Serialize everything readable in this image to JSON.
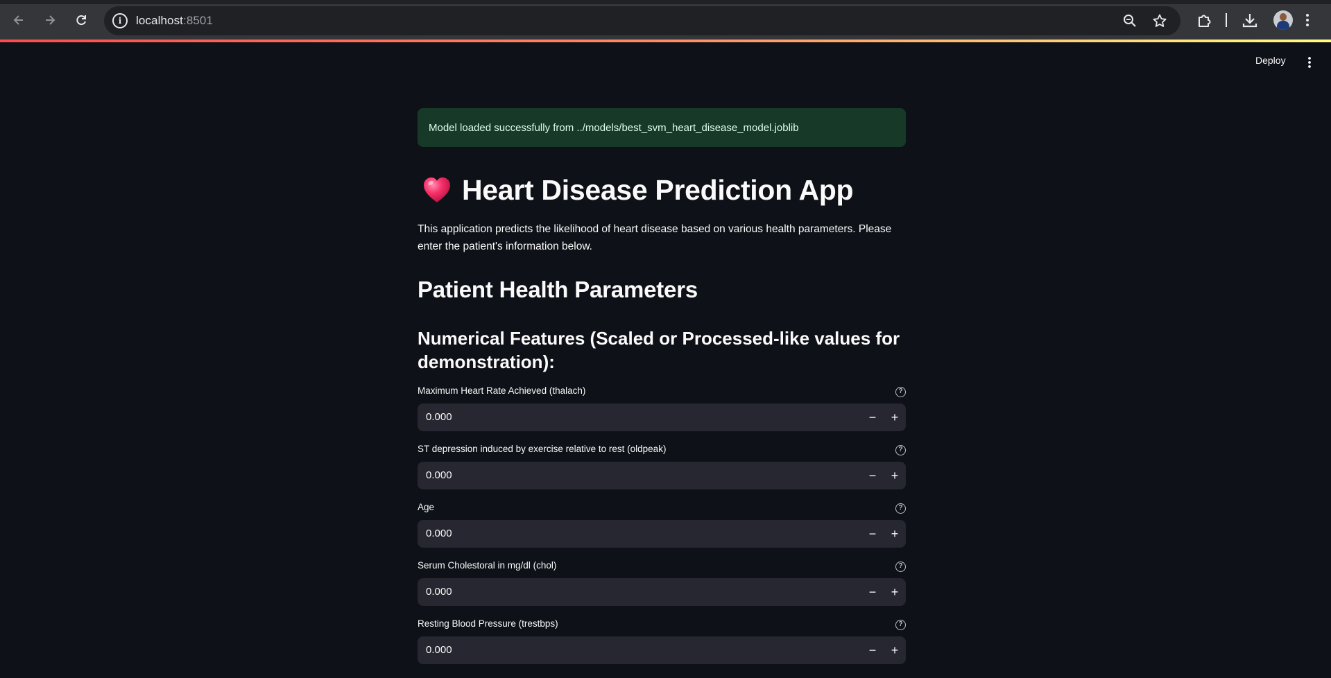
{
  "browser": {
    "url_host": "localhost",
    "url_port": ":8501",
    "icons": [
      "back-icon",
      "forward-icon",
      "reload-icon",
      "site-info-icon",
      "zoom-icon",
      "bookmark-star-icon",
      "extensions-icon",
      "download-icon",
      "avatar",
      "menu-icon"
    ]
  },
  "header": {
    "deploy_label": "Deploy"
  },
  "alert": {
    "message": "Model loaded successfully from ../models/best_svm_heart_disease_model.joblib"
  },
  "title": "Heart Disease Prediction App",
  "intro": "This application predicts the likelihood of heart disease based on various health parameters. Please enter the patient's information below.",
  "section_title": "Patient Health Parameters",
  "subsection_title": "Numerical Features (Scaled or Processed-like values for demonstration):",
  "fields": [
    {
      "label": "Maximum Heart Rate Achieved (thalach)",
      "value": "0.000"
    },
    {
      "label": "ST depression induced by exercise relative to rest (oldpeak)",
      "value": "0.000"
    },
    {
      "label": "Age",
      "value": "0.000"
    },
    {
      "label": "Serum Cholestoral in mg/dl (chol)",
      "value": "0.000"
    },
    {
      "label": "Resting Blood Pressure (trestbps)",
      "value": "0.000"
    }
  ],
  "stepper": {
    "minus": "−",
    "plus": "+"
  },
  "help_glyph": "?",
  "colors": {
    "background": "#0e1117",
    "alert_bg": "#173928",
    "input_bg": "#262730",
    "accent": "#ff4b4b"
  }
}
